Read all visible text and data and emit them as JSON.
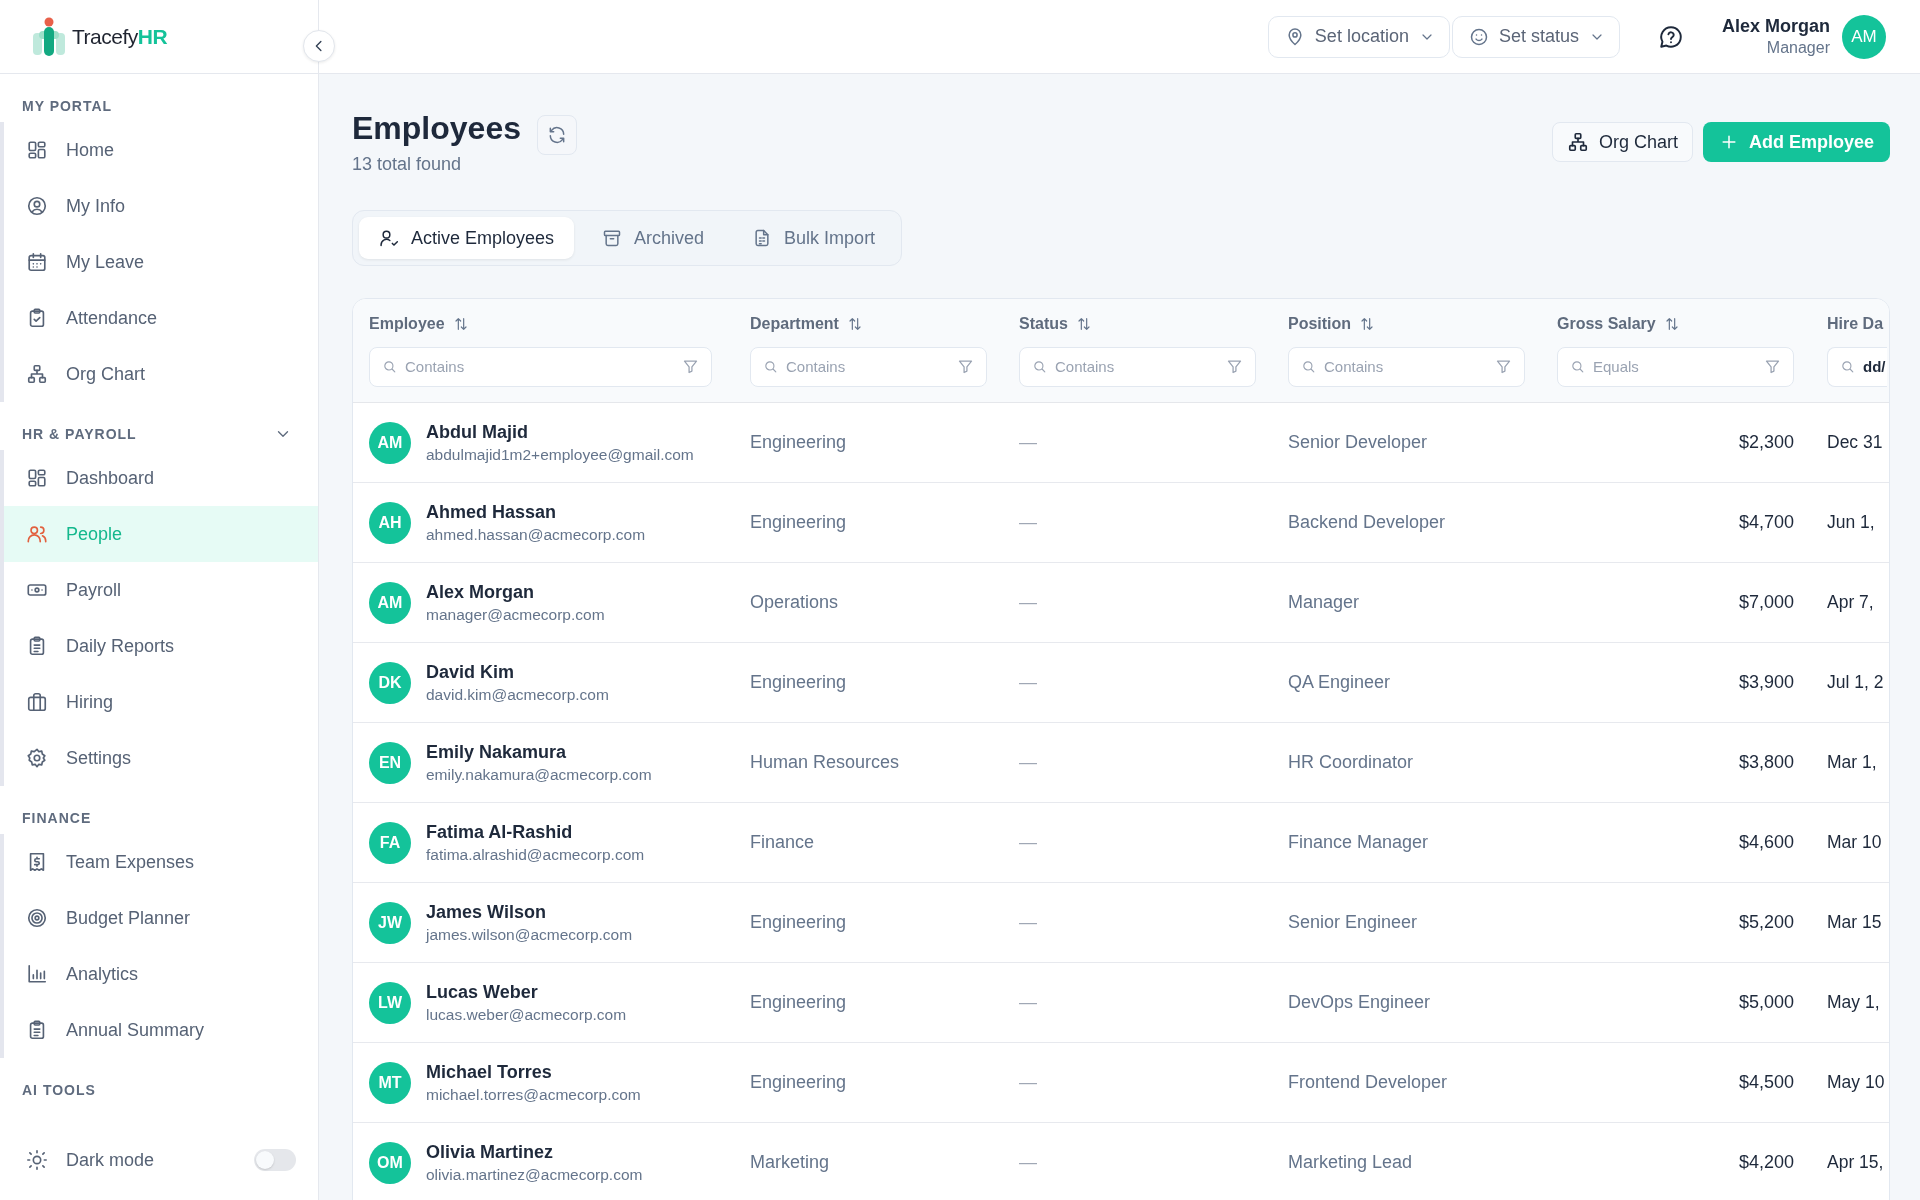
{
  "app": {
    "logo": "Tracefy**HR**"
  },
  "sidebar": {
    "sections": [
      {
        "title": "MY PORTAL",
        "items": [
          {
            "label": "Home",
            "selected": false
          },
          {
            "label": "My Info",
            "selected": false
          },
          {
            "label": "My Leave",
            "selected": false
          },
          {
            "label": "Attendance",
            "selected": false
          },
          {
            "label": "Org Chart",
            "selected": false
          }
        ]
      },
      {
        "title": "HR & PAYROLL",
        "expanded": true,
        "items": [
          {
            "label": "Dashboard",
            "selected": false
          },
          {
            "label": "People",
            "selected": true
          },
          {
            "label": "Payroll",
            "selected": false
          },
          {
            "label": "Daily Reports",
            "selected": false
          },
          {
            "label": "Hiring",
            "selected": false
          },
          {
            "label": "Settings",
            "selected": false
          }
        ]
      },
      {
        "title": "FINANCE",
        "items": [
          {
            "label": "Team Expenses",
            "selected": false
          },
          {
            "label": "Budget Planner",
            "selected": false
          },
          {
            "label": "Analytics",
            "selected": false
          },
          {
            "label": "Annual Summary",
            "selected": false
          }
        ]
      },
      {
        "title": "AI TOOLS"
      }
    ],
    "dark_mode": {
      "label": "Dark mode",
      "on": false
    }
  },
  "top_bar": {
    "location_button": "Set location",
    "status_button": "Set status",
    "user": {
      "name": "Alex Morgan",
      "role": "Manager",
      "initials": "AM"
    }
  },
  "page": {
    "title": "Employees",
    "count": "13 total found",
    "org_chart_button": "Org Chart",
    "add_button": "Add Employee"
  },
  "tabs": [
    {
      "label": "Active Employees",
      "selected": true
    },
    {
      "label": "Archived",
      "selected": false
    },
    {
      "label": "Bulk Import",
      "selected": false
    }
  ],
  "table": {
    "columns": [
      {
        "label": "Employee",
        "filter_placeholder": "Contains"
      },
      {
        "label": "Department",
        "filter_placeholder": "Contains"
      },
      {
        "label": "Status",
        "filter_placeholder": "Contains"
      },
      {
        "label": "Position",
        "filter_placeholder": "Contains"
      },
      {
        "label": "Gross Salary",
        "filter_placeholder": "Equals"
      },
      {
        "label": "Hire Da",
        "filter_placeholder": "dd/"
      }
    ],
    "rows": [
      {
        "initials": "AM",
        "name": "Abdul Majid",
        "email": "abdulmajid1m2+employee@gmail.com",
        "department": "Engineering",
        "status": "—",
        "position": "Senior Developer",
        "salary": "$2,300",
        "hire_date": "Dec 31"
      },
      {
        "initials": "AH",
        "name": "Ahmed Hassan",
        "email": "ahmed.hassan@acmecorp.com",
        "department": "Engineering",
        "status": "—",
        "position": "Backend Developer",
        "salary": "$4,700",
        "hire_date": "Jun 1,"
      },
      {
        "initials": "AM",
        "name": "Alex Morgan",
        "email": "manager@acmecorp.com",
        "department": "Operations",
        "status": "—",
        "position": "Manager",
        "salary": "$7,000",
        "hire_date": "Apr 7,"
      },
      {
        "initials": "DK",
        "name": "David Kim",
        "email": "david.kim@acmecorp.com",
        "department": "Engineering",
        "status": "—",
        "position": "QA Engineer",
        "salary": "$3,900",
        "hire_date": "Jul 1, 2"
      },
      {
        "initials": "EN",
        "name": "Emily Nakamura",
        "email": "emily.nakamura@acmecorp.com",
        "department": "Human Resources",
        "status": "—",
        "position": "HR Coordinator",
        "salary": "$3,800",
        "hire_date": "Mar 1,"
      },
      {
        "initials": "FA",
        "name": "Fatima Al-Rashid",
        "email": "fatima.alrashid@acmecorp.com",
        "department": "Finance",
        "status": "—",
        "position": "Finance Manager",
        "salary": "$4,600",
        "hire_date": "Mar 10"
      },
      {
        "initials": "JW",
        "name": "James Wilson",
        "email": "james.wilson@acmecorp.com",
        "department": "Engineering",
        "status": "—",
        "position": "Senior Engineer",
        "salary": "$5,200",
        "hire_date": "Mar 15"
      },
      {
        "initials": "LW",
        "name": "Lucas Weber",
        "email": "lucas.weber@acmecorp.com",
        "department": "Engineering",
        "status": "—",
        "position": "DevOps Engineer",
        "salary": "$5,000",
        "hire_date": "May 1,"
      },
      {
        "initials": "MT",
        "name": "Michael Torres",
        "email": "michael.torres@acmecorp.com",
        "department": "Engineering",
        "status": "—",
        "position": "Frontend Developer",
        "salary": "$4,500",
        "hire_date": "May 10"
      },
      {
        "initials": "OM",
        "name": "Olivia Martinez",
        "email": "olivia.martinez@acmecorp.com",
        "department": "Marketing",
        "status": "—",
        "position": "Marketing Lead",
        "salary": "$4,200",
        "hire_date": "Apr 15,"
      }
    ]
  }
}
